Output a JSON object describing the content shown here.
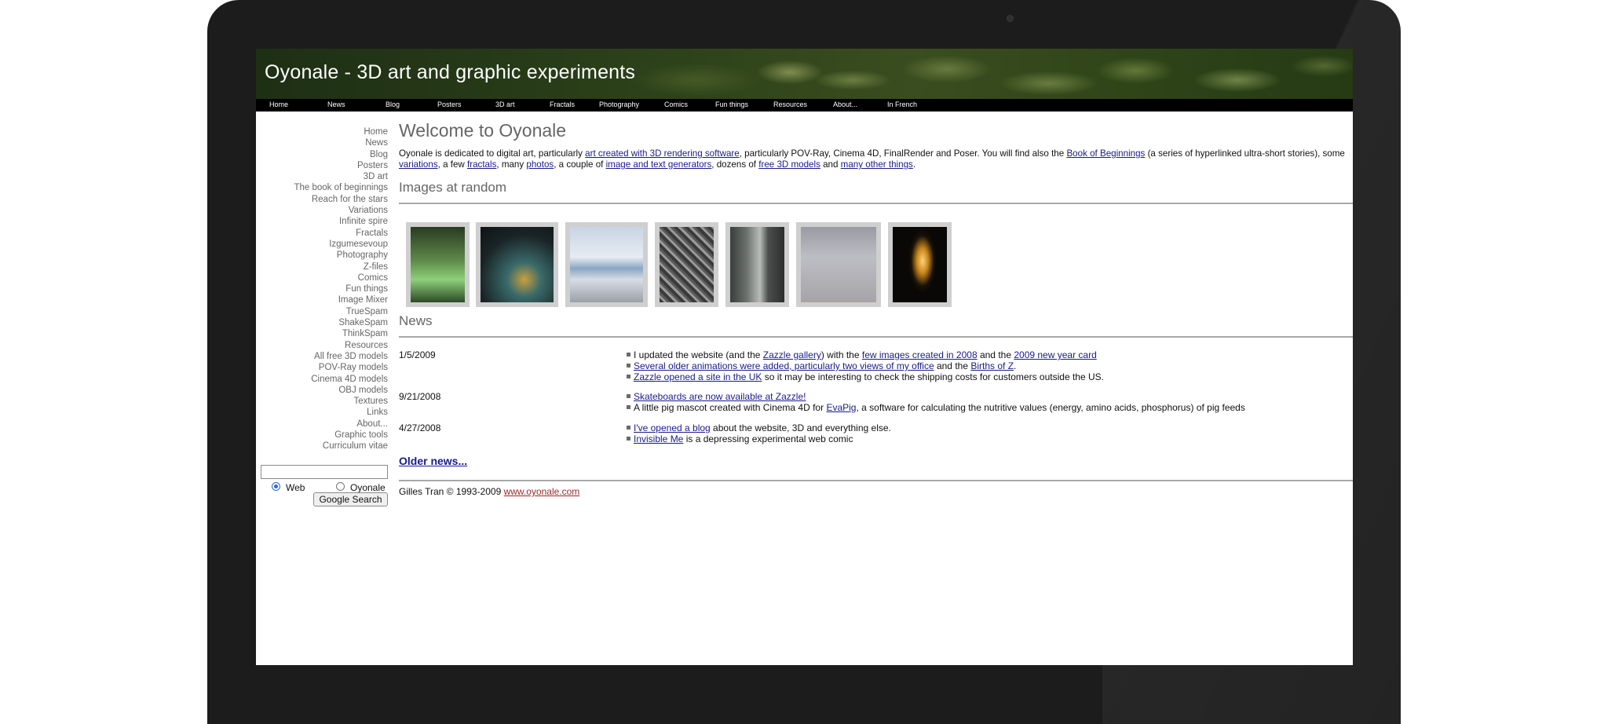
{
  "site": {
    "banner_title": "Oyonale - 3D art and graphic experiments"
  },
  "topnav": [
    "Home",
    "News",
    "Blog",
    "Posters",
    "3D art",
    "Fractals",
    "Photography",
    "Comics",
    "Fun things",
    "Resources",
    "About...",
    "In French"
  ],
  "sidebar": [
    "Home",
    "News",
    "Blog",
    "Posters",
    "3D art",
    "The book of beginnings",
    "Reach for the stars",
    "Variations",
    "Infinite spire",
    "Fractals",
    "Izgumesevoup",
    "Photography",
    "Z-files",
    "Comics",
    "Fun things",
    "Image Mixer",
    "TrueSpam",
    "ShakeSpam",
    "ThinkSpam",
    "Resources",
    "All free 3D models",
    "POV-Ray models",
    "Cinema 4D models",
    "OBJ models",
    "Textures",
    "Links",
    "About...",
    "Graphic tools",
    "Curriculum vitae"
  ],
  "search": {
    "value": "",
    "radio_web": "Web",
    "radio_site": "Oyonale",
    "selected": "Web",
    "button": "Google Search"
  },
  "main": {
    "heading": "Welcome to Oyonale",
    "intro": {
      "t1": "Oyonale is dedicated to digital art, particularly ",
      "a1": "art created with 3D rendering software",
      "t2": ", particularly POV-Ray, Cinema 4D, FinalRender and Poser. You will find also the ",
      "a2": "Book of Beginnings",
      "t3": " (a series of hyperlinked ultra-short stories), some ",
      "a3": "variations",
      "t4": ", a few ",
      "a4": "fractals",
      "t5": ", many ",
      "a5": "photos",
      "t6": ", a couple of ",
      "a6": "image and text generators",
      "t7": ", dozens of ",
      "a7": "free 3D models",
      "t8": " and ",
      "a8": "many other things",
      "t9": "."
    },
    "images_heading": "Images at random",
    "news_heading": "News",
    "news": [
      {
        "date": "1/5/2009",
        "items": [
          {
            "t1": "I updated the website (and the ",
            "a1": "Zazzle gallery",
            "t2": ") with the ",
            "a2": "few images created in 2008",
            "t3": " and the ",
            "a3": "2009 new year card",
            "t4": ""
          },
          {
            "t1": "",
            "a1": "Several older animations were added, particularly two views of my office",
            "t2": " and the ",
            "a2": "Births of Z",
            "t3": ".",
            "a3": "",
            "t4": ""
          },
          {
            "t1": "",
            "a1": "Zazzle opened a site in the UK",
            "t2": " so it may be interesting to check the shipping costs for customers outside the US.",
            "a2": "",
            "t3": "",
            "a3": "",
            "t4": ""
          }
        ]
      },
      {
        "date": "9/21/2008",
        "items": [
          {
            "t1": "",
            "a1": "Skateboards are now available at Zazzle!",
            "t2": "",
            "a2": "",
            "t3": "",
            "a3": "",
            "t4": ""
          },
          {
            "t1": "A little pig mascot created with Cinema 4D for ",
            "a1": "EvaPig",
            "t2": ", a software for calculating the nutritive values (energy, amino acids, phosphorus) of pig feeds",
            "a2": "",
            "t3": "",
            "a3": "",
            "t4": ""
          }
        ]
      },
      {
        "date": "4/27/2008",
        "items": [
          {
            "t1": "",
            "a1": "I've opened a blog",
            "t2": " about the website, 3D and everything else.",
            "a2": "",
            "t3": "",
            "a3": "",
            "t4": ""
          },
          {
            "t1": "",
            "a1": "Invisible Me",
            "t2": " is a depressing experimental web comic",
            "a2": "",
            "t3": "",
            "a3": "",
            "t4": ""
          }
        ]
      }
    ],
    "older_news": "Older news...",
    "footer_text": "Gilles Tran © 1993-2009 ",
    "footer_link": "www.oyonale.com"
  },
  "colors": {
    "link": "#1a1a8c",
    "heading": "#666666",
    "nav_bg": "#000000",
    "footer_link": "#9a2a2a"
  }
}
